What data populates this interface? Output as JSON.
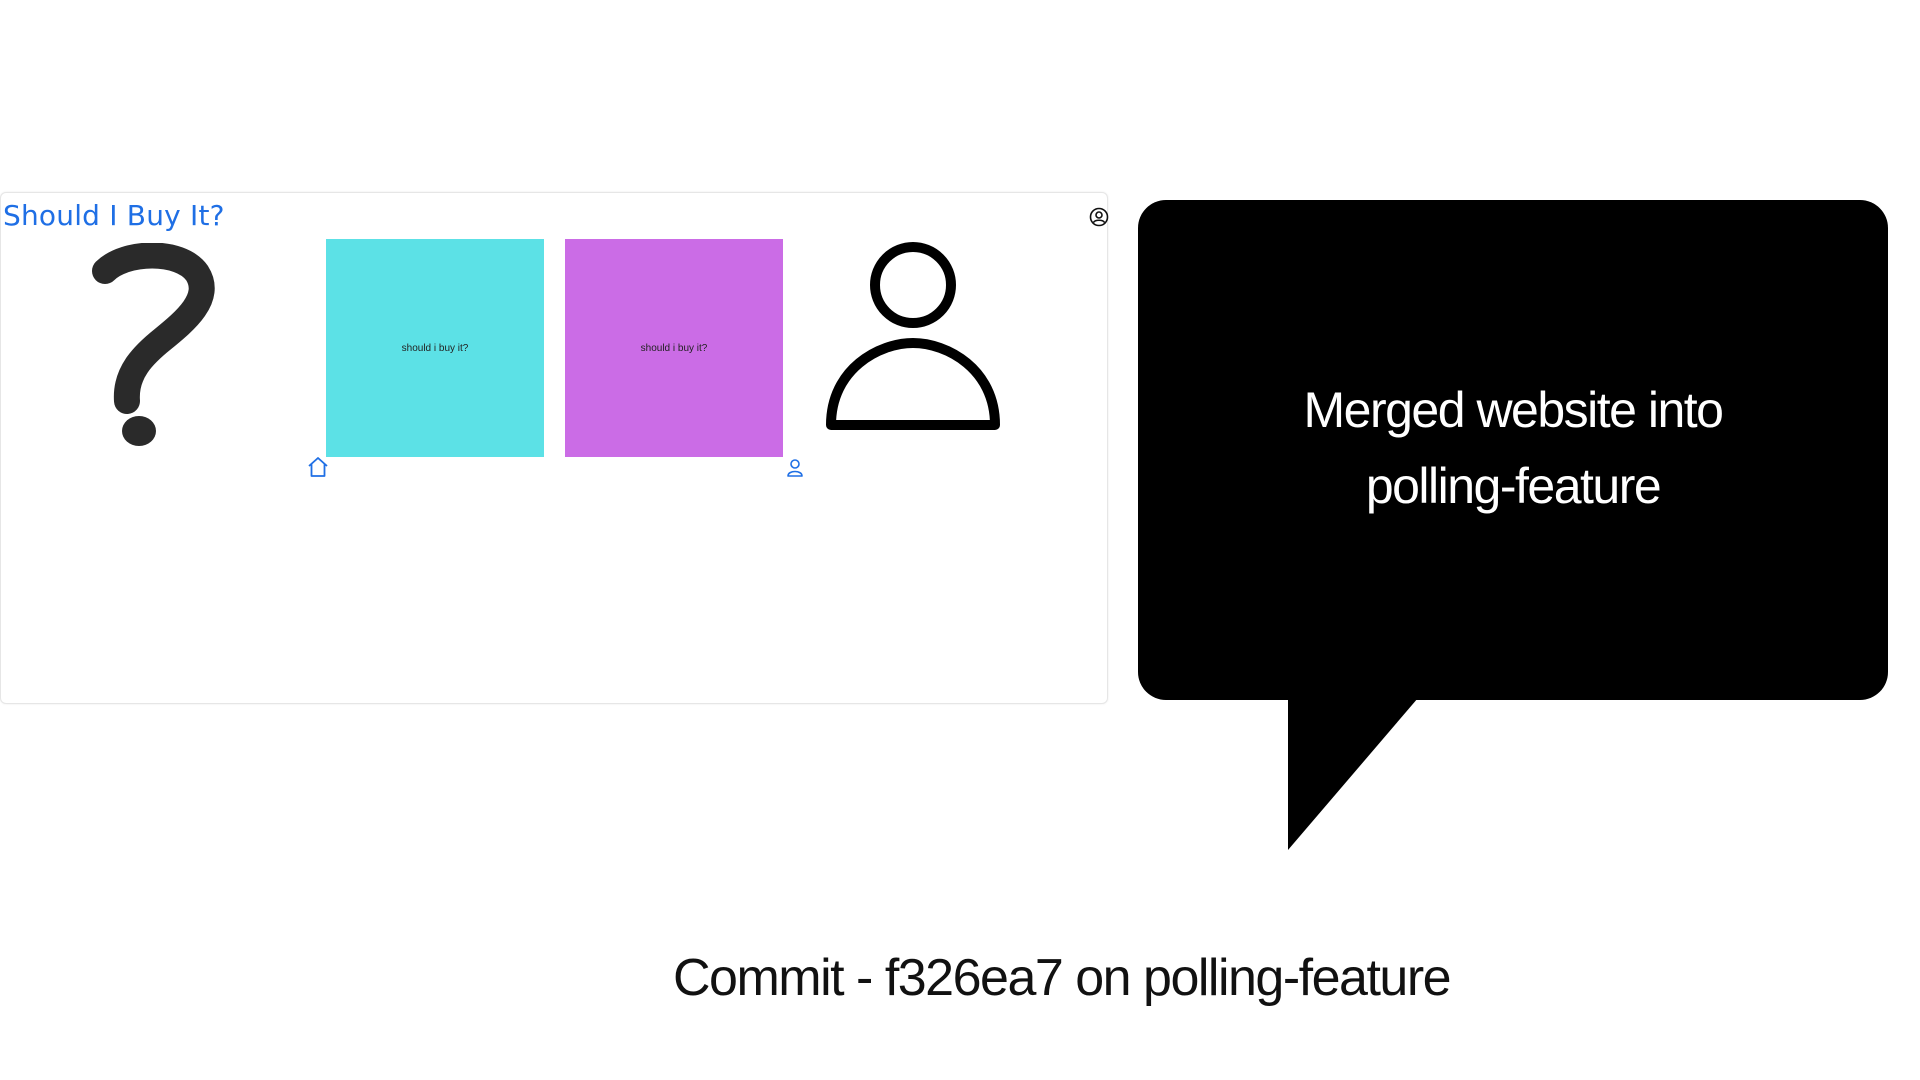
{
  "website": {
    "title": "Should I Buy It?",
    "cards": [
      {
        "label": "should i buy it?",
        "color": "#5ce1e6"
      },
      {
        "label": "should i buy it?",
        "color": "#cb6ce6"
      }
    ],
    "icons": {
      "account": "account-circle-icon",
      "question": "question-mark-icon",
      "person": "person-icon",
      "home": "home-icon",
      "user": "user-icon"
    },
    "accent_color": "#1f6fe5"
  },
  "bubble": {
    "line1": "Merged website into",
    "line2": "polling-feature"
  },
  "commit": {
    "text": "Commit -  f326ea7 on polling-feature"
  }
}
